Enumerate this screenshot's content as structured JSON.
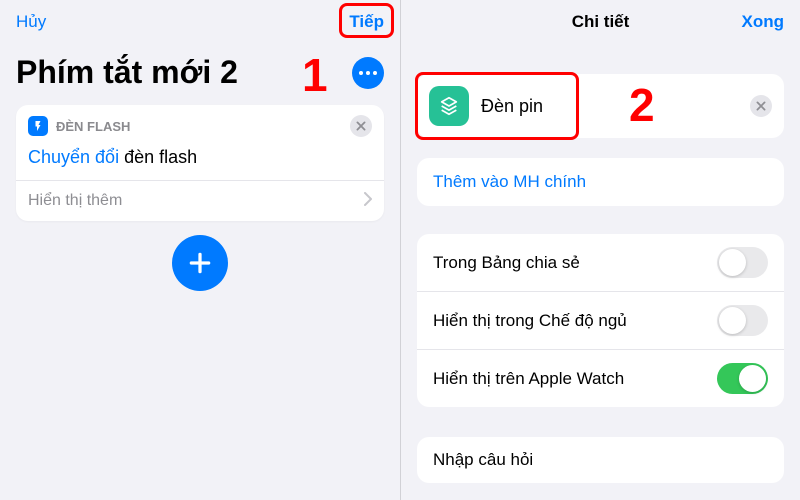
{
  "left": {
    "nav": {
      "cancel": "Hủy",
      "next": "Tiếp"
    },
    "title": "Phím tắt mới 2",
    "action_card": {
      "header": "ĐÈN FLASH",
      "highlight": "Chuyển đổi",
      "normal": "đèn flash",
      "show_more": "Hiển thị thêm"
    }
  },
  "right": {
    "nav": {
      "title": "Chi tiết",
      "done": "Xong"
    },
    "name_field": {
      "value": "Đèn pin"
    },
    "add_home": "Thêm vào MH chính",
    "toggles": [
      {
        "label": "Trong Bảng chia sẻ",
        "on": false
      },
      {
        "label": "Hiển thị trong Chế độ ngủ",
        "on": false
      },
      {
        "label": "Hiển thị trên Apple Watch",
        "on": true
      }
    ],
    "input_question": "Nhập câu hỏi"
  },
  "annotations": {
    "one": "1",
    "two": "2"
  }
}
